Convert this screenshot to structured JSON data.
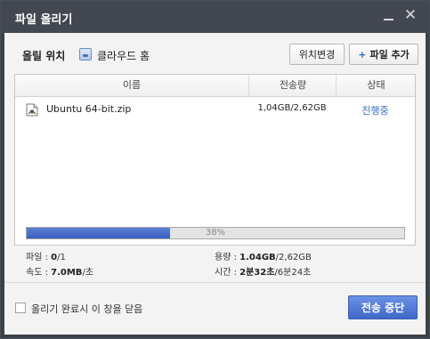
{
  "window": {
    "title": "파일 올리기"
  },
  "location": {
    "label": "올릴 위치",
    "value": "클라우드 홈",
    "change_label": "위치변경",
    "add_label": "파일 추가"
  },
  "table": {
    "columns": [
      "이름",
      "전송량",
      "상태"
    ],
    "rows": [
      {
        "name": "Ubuntu 64-bit.zip",
        "size": "1,04GB/2,62GB",
        "status": "진행중"
      }
    ]
  },
  "progress": {
    "value": 0.38,
    "label": "38%"
  },
  "stats": {
    "files_label": "파일 :",
    "files_value": "0",
    "files_total": "/1",
    "speed_label": "속도 :",
    "speed_value": "7.0MB",
    "speed_unit": "/초",
    "capacity_label": "용량 :",
    "capacity_value": "1.04GB",
    "capacity_total": "/2,62GB",
    "time_label": "시간 :",
    "time_value": "2분32초",
    "time_total": "/6분24초"
  },
  "footer": {
    "close_on_complete_label": "올리기 완료시 이 창을 닫음",
    "close_on_complete_checked": false,
    "stop_label": "전송 중단"
  },
  "colors": {
    "accent": "#3f68c8",
    "status_text": "#3a6bc4",
    "titlebar": "#43474f"
  }
}
